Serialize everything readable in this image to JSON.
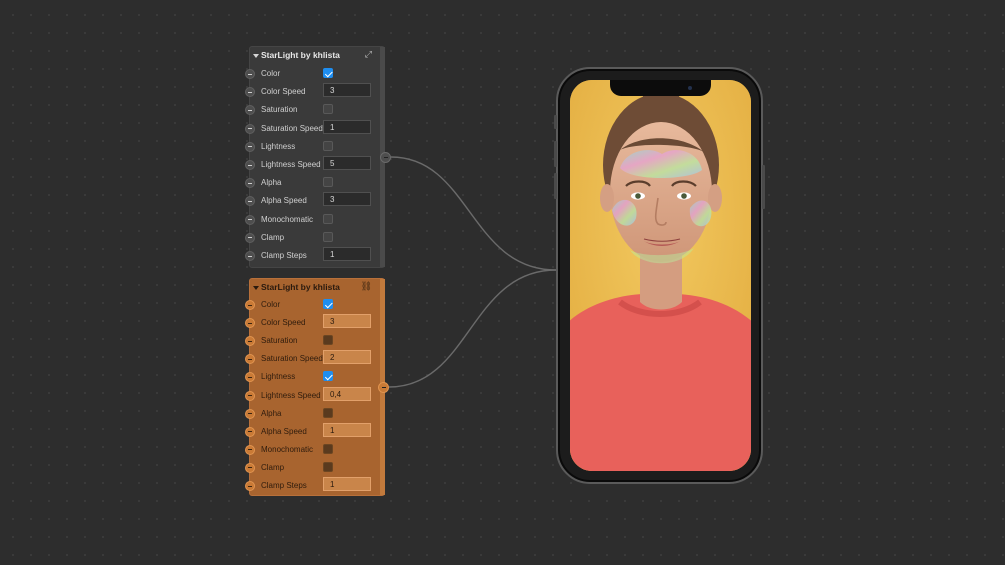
{
  "nodes": [
    {
      "title": "StarLight by khlista",
      "theme": "gray",
      "header_icon": "expand-icon",
      "params": [
        {
          "label": "Color",
          "type": "checkbox",
          "checked": true
        },
        {
          "label": "Color Speed",
          "type": "field",
          "value": "3"
        },
        {
          "label": "Saturation",
          "type": "checkbox",
          "checked": false
        },
        {
          "label": "Saturation Speed",
          "type": "field",
          "value": "1"
        },
        {
          "label": "Lightness",
          "type": "checkbox",
          "checked": false
        },
        {
          "label": "Lightness Speed",
          "type": "field",
          "value": "5"
        },
        {
          "label": "Alpha",
          "type": "checkbox",
          "checked": false
        },
        {
          "label": "Alpha Speed",
          "type": "field",
          "value": "3"
        },
        {
          "label": "Monochomatic",
          "type": "checkbox",
          "checked": false
        },
        {
          "label": "Clamp",
          "type": "checkbox",
          "checked": false
        },
        {
          "label": "Clamp Steps",
          "type": "field",
          "value": "1"
        }
      ]
    },
    {
      "title": "StarLight by khlista",
      "theme": "orange",
      "header_icon": "link-icon",
      "params": [
        {
          "label": "Color",
          "type": "checkbox",
          "checked": true
        },
        {
          "label": "Color Speed",
          "type": "field",
          "value": "3"
        },
        {
          "label": "Saturation",
          "type": "checkbox",
          "checked": false
        },
        {
          "label": "Saturation Speed",
          "type": "field",
          "value": "2"
        },
        {
          "label": "Lightness",
          "type": "checkbox",
          "checked": true
        },
        {
          "label": "Lightness Speed",
          "type": "field",
          "value": "0,4"
        },
        {
          "label": "Alpha",
          "type": "checkbox",
          "checked": false
        },
        {
          "label": "Alpha Speed",
          "type": "field",
          "value": "1"
        },
        {
          "label": "Monochomatic",
          "type": "checkbox",
          "checked": false
        },
        {
          "label": "Clamp",
          "type": "checkbox",
          "checked": false
        },
        {
          "label": "Clamp Steps",
          "type": "field",
          "value": "1"
        }
      ]
    }
  ],
  "preview": {
    "device": "smartphone",
    "background_color": "#eab94c",
    "shirt_color": "#e8615b",
    "effect": "rainbow-light-face-overlay"
  },
  "colors": {
    "canvas": "#2d2d2d",
    "node_gray": "#3a3a3a",
    "node_orange": "#a8642f",
    "checkbox_accent": "#1f8ef0",
    "wire": "#6a6a6a"
  }
}
